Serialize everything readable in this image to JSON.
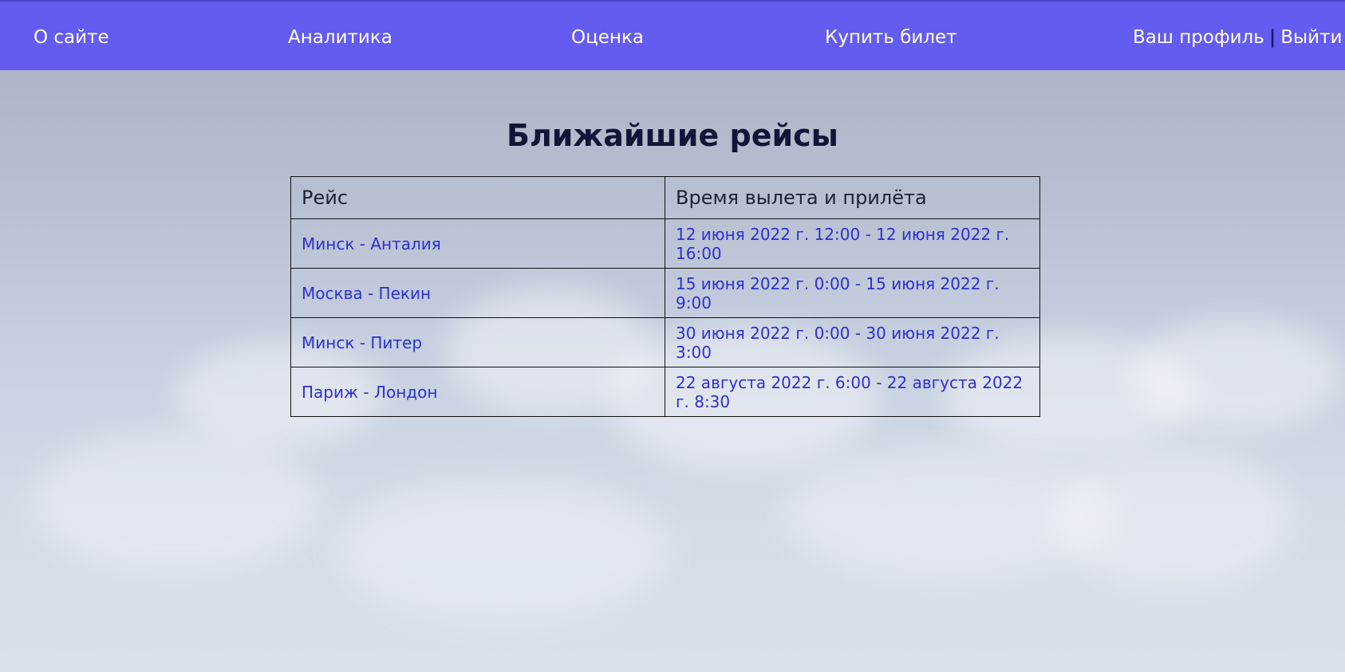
{
  "nav": {
    "about": "О сайте",
    "analytics": "Аналитика",
    "rating": "Оценка",
    "buy_ticket": "Купить билет",
    "profile": "Ваш профиль",
    "separator": "|",
    "logout": "Выйти"
  },
  "main": {
    "title": "Ближайшие рейсы",
    "table": {
      "headers": [
        "Рейс",
        "Время вылета и прилёта"
      ],
      "rows": [
        {
          "route": "Минск - Анталия",
          "time": "12 июня 2022 г. 12:00 - 12 июня 2022 г. 16:00"
        },
        {
          "route": "Москва - Пекин",
          "time": "15 июня 2022 г. 0:00 - 15 июня 2022 г. 9:00"
        },
        {
          "route": "Минск - Питер",
          "time": "30 июня 2022 г. 0:00 - 30 июня 2022 г. 3:00"
        },
        {
          "route": "Париж - Лондон",
          "time": "22 августа 2022 г. 6:00 - 22 августа 2022 г. 8:30"
        }
      ]
    }
  },
  "colors": {
    "nav_background": "#645bf0",
    "link": "#2e2fd2",
    "title": "#0f1636"
  }
}
